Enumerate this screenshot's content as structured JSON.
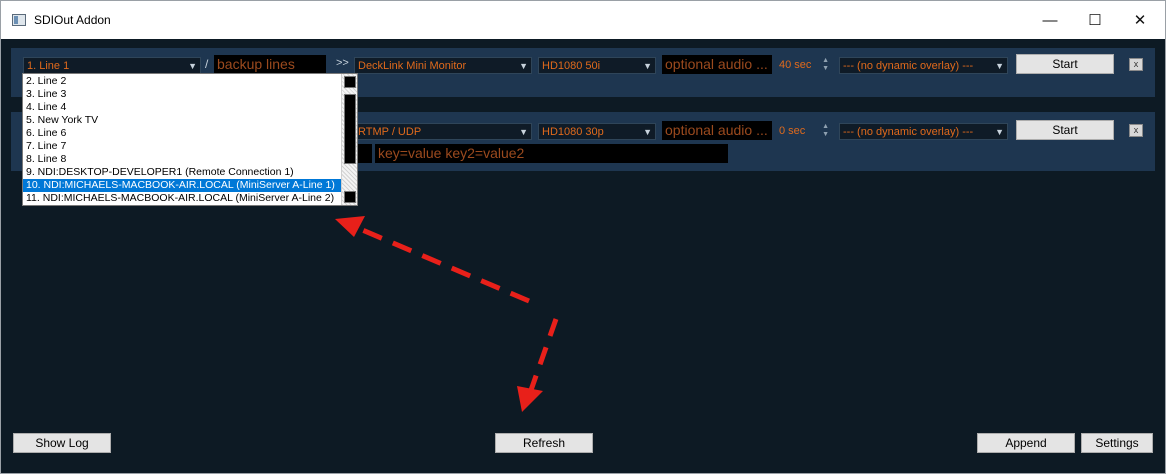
{
  "window": {
    "title": "SDIOut Addon",
    "minimize": "—",
    "maximize": "☐",
    "close": "✕"
  },
  "row1": {
    "source": "1. Line 1",
    "separator": "/",
    "backup_placeholder": "backup lines",
    "arrow": ">>",
    "output": "DeckLink Mini Monitor",
    "format": "HD1080  50i",
    "audio_placeholder": "optional audio ...",
    "delay": "40 sec",
    "overlay": "--- (no dynamic overlay) ---",
    "start": "Start",
    "remove": "x"
  },
  "row2": {
    "output": "RTMP / UDP",
    "format": "HD1080  30p",
    "audio_placeholder": "optional audio ...",
    "delay": "0 sec",
    "overlay": "--- (no dynamic overlay) ---",
    "start": "Start",
    "remove": "x",
    "params_placeholder": "key=value key2=value2"
  },
  "dropdown": {
    "items": [
      "2. Line 2",
      "3. Line 3",
      "4. Line 4",
      "5. New York TV",
      "6. Line 6",
      "7. Line 7",
      "8. Line 8",
      "9. NDI:DESKTOP-DEVELOPER1 (Remote Connection 1)",
      "10. NDI:MICHAELS-MACBOOK-AIR.LOCAL (MiniServer A-Line 1)",
      "11. NDI:MICHAELS-MACBOOK-AIR.LOCAL (MiniServer A-Line 2)"
    ],
    "selected_index": 8
  },
  "footer": {
    "show_log": "Show Log",
    "refresh": "Refresh",
    "append": "Append",
    "settings": "Settings"
  },
  "colors": {
    "background": "#0d1a24",
    "row": "#1e3650",
    "accent": "#e06a1c",
    "selection": "#0078d7",
    "annotation_arrow": "#e8201a"
  },
  "icons": {
    "dropdown": "chevron-down-icon",
    "spin": "spin-up-down-icon"
  }
}
